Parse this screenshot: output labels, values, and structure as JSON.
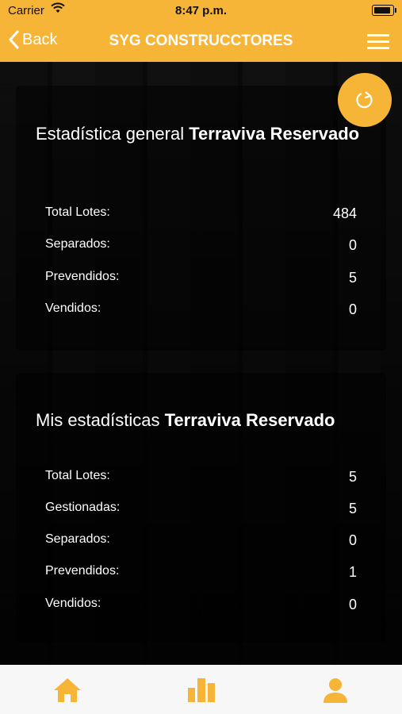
{
  "status_bar": {
    "carrier": "Carrier",
    "time": "8:47 p.m."
  },
  "nav_bar": {
    "back_label": "Back",
    "title": "SYG CONSTRUCCTORES"
  },
  "general_stats": {
    "title_prefix": "Estadística general",
    "project_name": "Terraviva Reservado",
    "rows": [
      {
        "label": "Total Lotes:",
        "value": "484"
      },
      {
        "label": "Separados:",
        "value": "0"
      },
      {
        "label": "Prevendidos:",
        "value": "5"
      },
      {
        "label": "Vendidos:",
        "value": "0"
      }
    ]
  },
  "my_stats": {
    "title_prefix": "Mis estadísticas",
    "project_name": "Terraviva Reservado",
    "rows": [
      {
        "label": "Total Lotes:",
        "value": "5"
      },
      {
        "label": "Gestionadas:",
        "value": "5"
      },
      {
        "label": "Separados:",
        "value": "0"
      },
      {
        "label": "Prevendidos:",
        "value": "1"
      },
      {
        "label": "Vendidos:",
        "value": "0"
      }
    ]
  },
  "colors": {
    "accent": "#f7b538",
    "tab_bar_bg": "#f7f7f7"
  },
  "icons": {
    "refresh": "refresh-icon",
    "tabs": [
      "home-icon",
      "stats-icon",
      "user-icon"
    ]
  }
}
